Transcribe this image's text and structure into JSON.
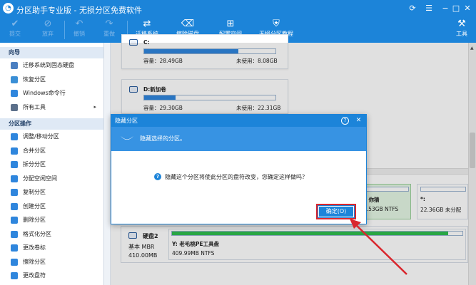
{
  "window": {
    "title": "分区助手专业版 - 无损分区免费软件"
  },
  "toolbar": {
    "commit": "提交",
    "discard": "放弃",
    "undo": "撤销",
    "redo": "重做",
    "migrate_os": "迁移系统",
    "wipe_disk": "擦除磁盘",
    "allocate_space": "配置空间",
    "tutorial": "无损分区教程",
    "tools": "工具"
  },
  "sidebar": {
    "wizard_header": "向导",
    "wizard_items": [
      {
        "label": "迁移系统到固态硬盘"
      },
      {
        "label": "恢复分区"
      },
      {
        "label": "Windows命令行"
      },
      {
        "label": "所有工具",
        "arrow": "▸"
      }
    ],
    "ops_header": "分区操作",
    "ops_items": [
      {
        "label": "调整/移动分区"
      },
      {
        "label": "合并分区"
      },
      {
        "label": "拆分分区"
      },
      {
        "label": "分配空闲空间"
      },
      {
        "label": "复制分区"
      },
      {
        "label": "创建分区"
      },
      {
        "label": "删除分区"
      },
      {
        "label": "格式化分区"
      },
      {
        "label": "更改卷标"
      },
      {
        "label": "擦除分区"
      },
      {
        "label": "更改盘符"
      }
    ]
  },
  "partitions": [
    {
      "name": "C:",
      "capacity": "容量：28.49GB",
      "unused": "未使用：8.08GB",
      "fill": 0.72
    },
    {
      "name": "D:新加卷",
      "capacity": "容量：29.30GB",
      "unused": "未使用：22.31GB",
      "fill": 0.24
    }
  ],
  "drive_strip": {
    "e_label": "：你猜",
    "e_size": "9.53GB NTFS",
    "e_fill": 0.05,
    "star_label": "*:",
    "star_size": "22.36GB 未分配"
  },
  "disk2": {
    "name": "硬盘2",
    "type": "基本 MBR",
    "size": "410.00MB",
    "part_label": "Y: 老毛桃PE工具盘",
    "part_size": "409.99MB NTFS",
    "fill": 0.95
  },
  "dialog": {
    "title": "隐藏分区",
    "banner_text": "隐藏选择的分区。",
    "message": "隐藏这个分区将使此分区的盘符改变，您确定这样做吗？",
    "ok_label": "确定(O)",
    "help": "?",
    "close": "✕"
  },
  "colors": {
    "accent": "#1c84d9",
    "highlight": "#d9272e"
  }
}
